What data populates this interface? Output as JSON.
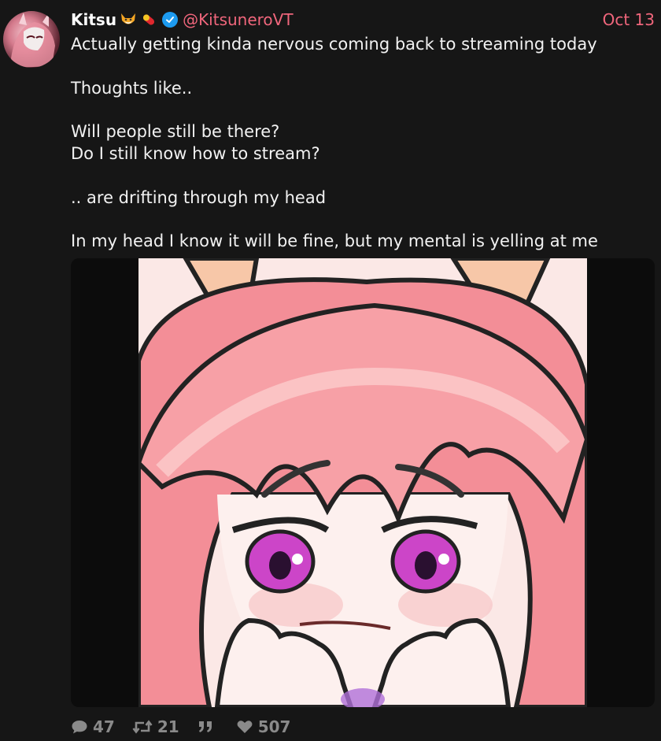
{
  "tweet": {
    "author": {
      "display_name": "Kitsu",
      "handle": "@KitsuneroVT",
      "name_emojis": [
        "fox-emoji",
        "pill-emoji"
      ],
      "verified": true
    },
    "date": "Oct 13",
    "lines": [
      "Actually getting kinda nervous coming back to streaming today",
      "Thoughts like..",
      "Will people still be there?",
      "Do I still know how to stream?",
      ".. are drifting through my head",
      "In my head I know it will be fine, but my mental is yelling at me"
    ],
    "media": {
      "kind": "image",
      "subject": "pink-haired anime fox girl covering mouth nervously"
    },
    "stats": {
      "replies": "47",
      "retweets": "21",
      "quotes": "",
      "likes": "507"
    }
  },
  "colors": {
    "background": "#161616",
    "accent": "#f0667c",
    "muted": "#8a8a8a",
    "verified": "#1d9bf0"
  }
}
